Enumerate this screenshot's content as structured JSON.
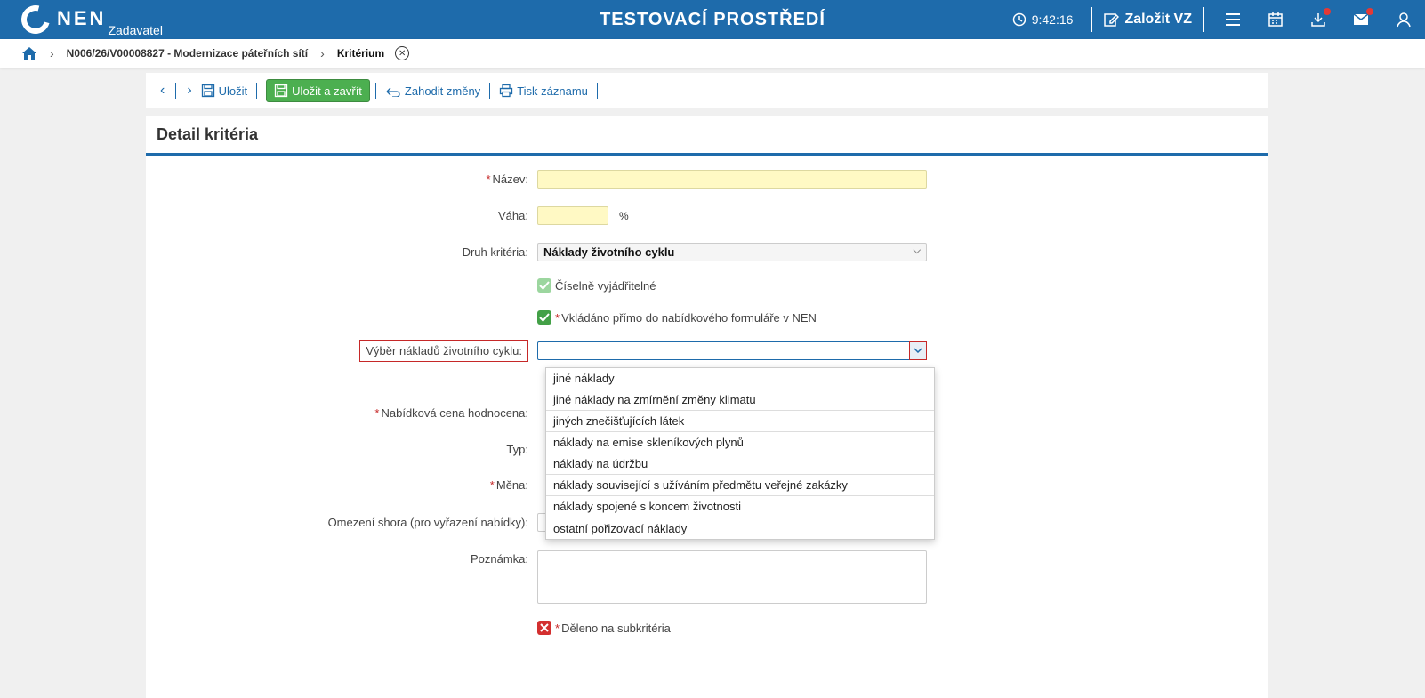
{
  "header": {
    "logo_text": "NEN",
    "logo_sub": "Zadavatel",
    "env_title": "TESTOVACÍ PROSTŘEDÍ",
    "time": "9:42:16",
    "create_label": "Založit VZ"
  },
  "breadcrumb": {
    "item": "N006/26/V00008827 - Modernizace páteřních sítí",
    "current": "Kritérium"
  },
  "toolbar": {
    "save": "Uložit",
    "save_close": "Uložit a zavřít",
    "discard": "Zahodit změny",
    "print": "Tisk záznamu"
  },
  "panel": {
    "title": "Detail kritéria"
  },
  "form": {
    "nazev_label": "Název:",
    "vaha_label": "Váha:",
    "vaha_unit": "%",
    "druh_label": "Druh kritéria:",
    "druh_value": "Náklady životního cyklu",
    "ciselne_label": "Číselně vyjádřitelné",
    "vkladano_label": "Vkládáno přímo do nabídkového formuláře v NEN",
    "lc_label": "Výběr nákladů životního cyklu:",
    "cena_label": "Nabídková cena hodnocena:",
    "typ_label": "Typ:",
    "mena_label": "Měna:",
    "omezeni_label": "Omezení shora (pro vyřazení nabídky):",
    "poznamka_label": "Poznámka:",
    "deleno_label": "Děleno na subkritéria"
  },
  "dropdown": {
    "options": [
      "jiné náklady",
      "jiné náklady na zmírnění změny klimatu",
      "jiných znečišťujících látek",
      "náklady na emise skleníkových plynů",
      "náklady na údržbu",
      "náklady související s užíváním předmětu veřejné zakázky",
      "náklady spojené s koncem životnosti",
      "ostatní pořizovací náklady"
    ]
  },
  "colors": {
    "brand": "#1e6bab",
    "primary_button": "#4caf50",
    "required": "#c62828",
    "input_yellow": "#fff9c4"
  }
}
